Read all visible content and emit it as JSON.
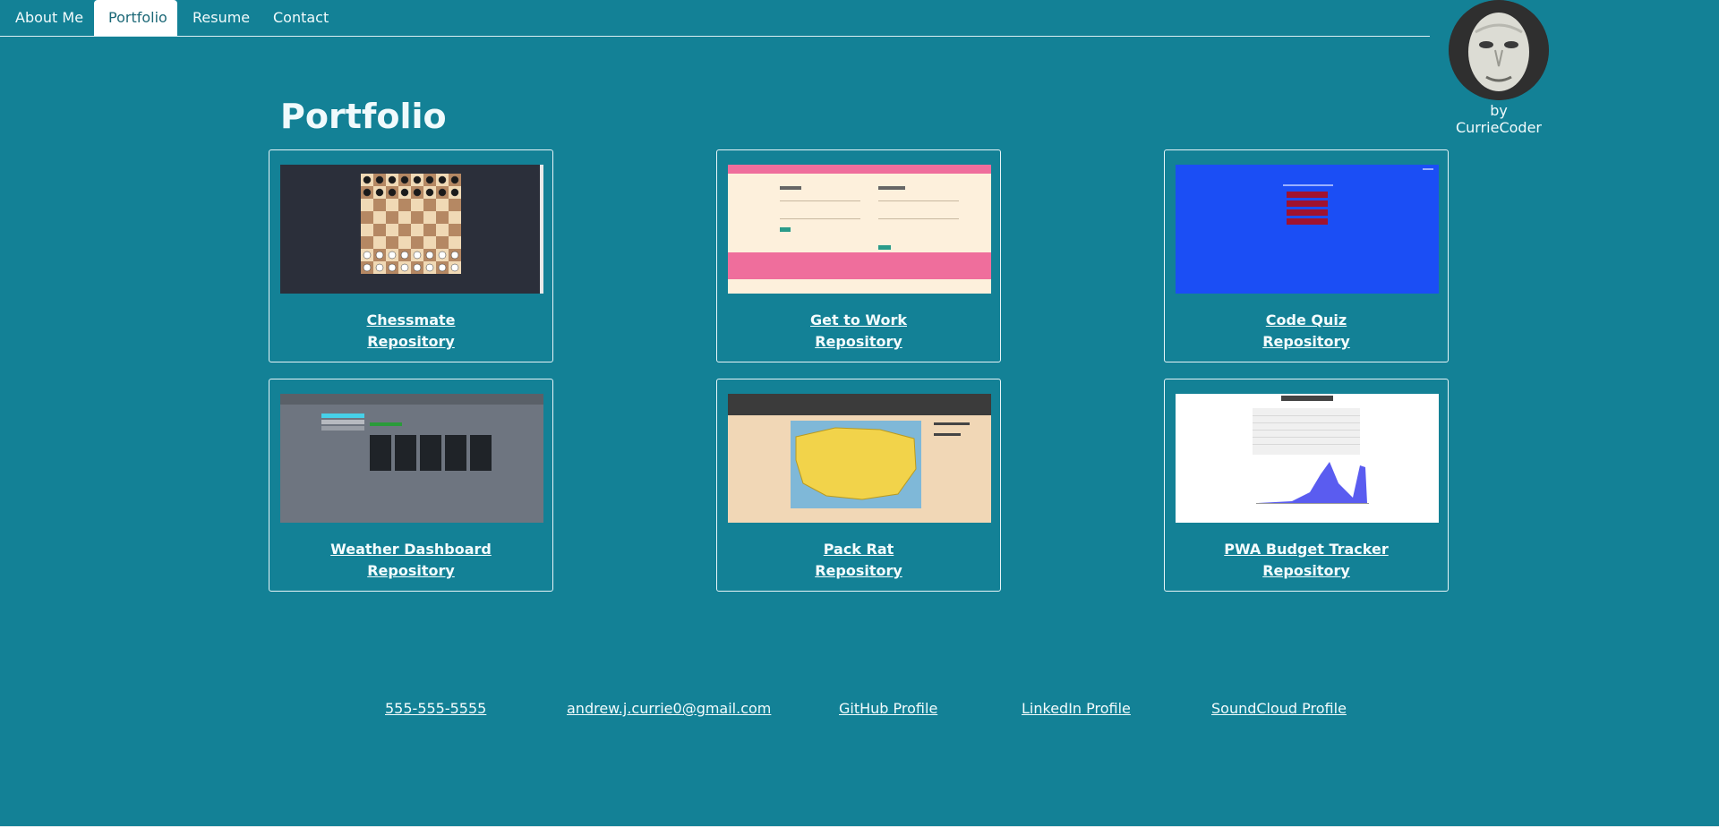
{
  "nav": {
    "items": [
      {
        "label": "About Me",
        "active": false
      },
      {
        "label": "Portfolio",
        "active": true
      },
      {
        "label": "Resume",
        "active": false
      },
      {
        "label": "Contact",
        "active": false
      }
    ]
  },
  "profile": {
    "byline": "by CurrieCoder"
  },
  "page": {
    "title": "Portfolio"
  },
  "projects": [
    {
      "title": "Chessmate",
      "repo_label": "Repository",
      "thumb_icon": "chessboard-screenshot"
    },
    {
      "title": "Get to Work",
      "repo_label": "Repository",
      "thumb_icon": "login-signup-screenshot"
    },
    {
      "title": "Code Quiz",
      "repo_label": "Repository",
      "thumb_icon": "quiz-screenshot"
    },
    {
      "title": "Weather Dashboard",
      "repo_label": "Repository",
      "thumb_icon": "weather-screenshot"
    },
    {
      "title": "Pack Rat",
      "repo_label": "Repository",
      "thumb_icon": "usa-map-screenshot"
    },
    {
      "title": "PWA Budget Tracker",
      "repo_label": "Repository",
      "thumb_icon": "budget-chart-screenshot"
    }
  ],
  "footer": {
    "phone": "555-555-5555",
    "email": "andrew.j.currie0@gmail.com",
    "github": "GitHub Profile",
    "linkedin": "LinkedIn Profile",
    "soundcloud": "SoundCloud Profile"
  },
  "colors": {
    "background": "#138196",
    "nav_active_bg": "#ffffff",
    "text": "#f2fbfc"
  }
}
